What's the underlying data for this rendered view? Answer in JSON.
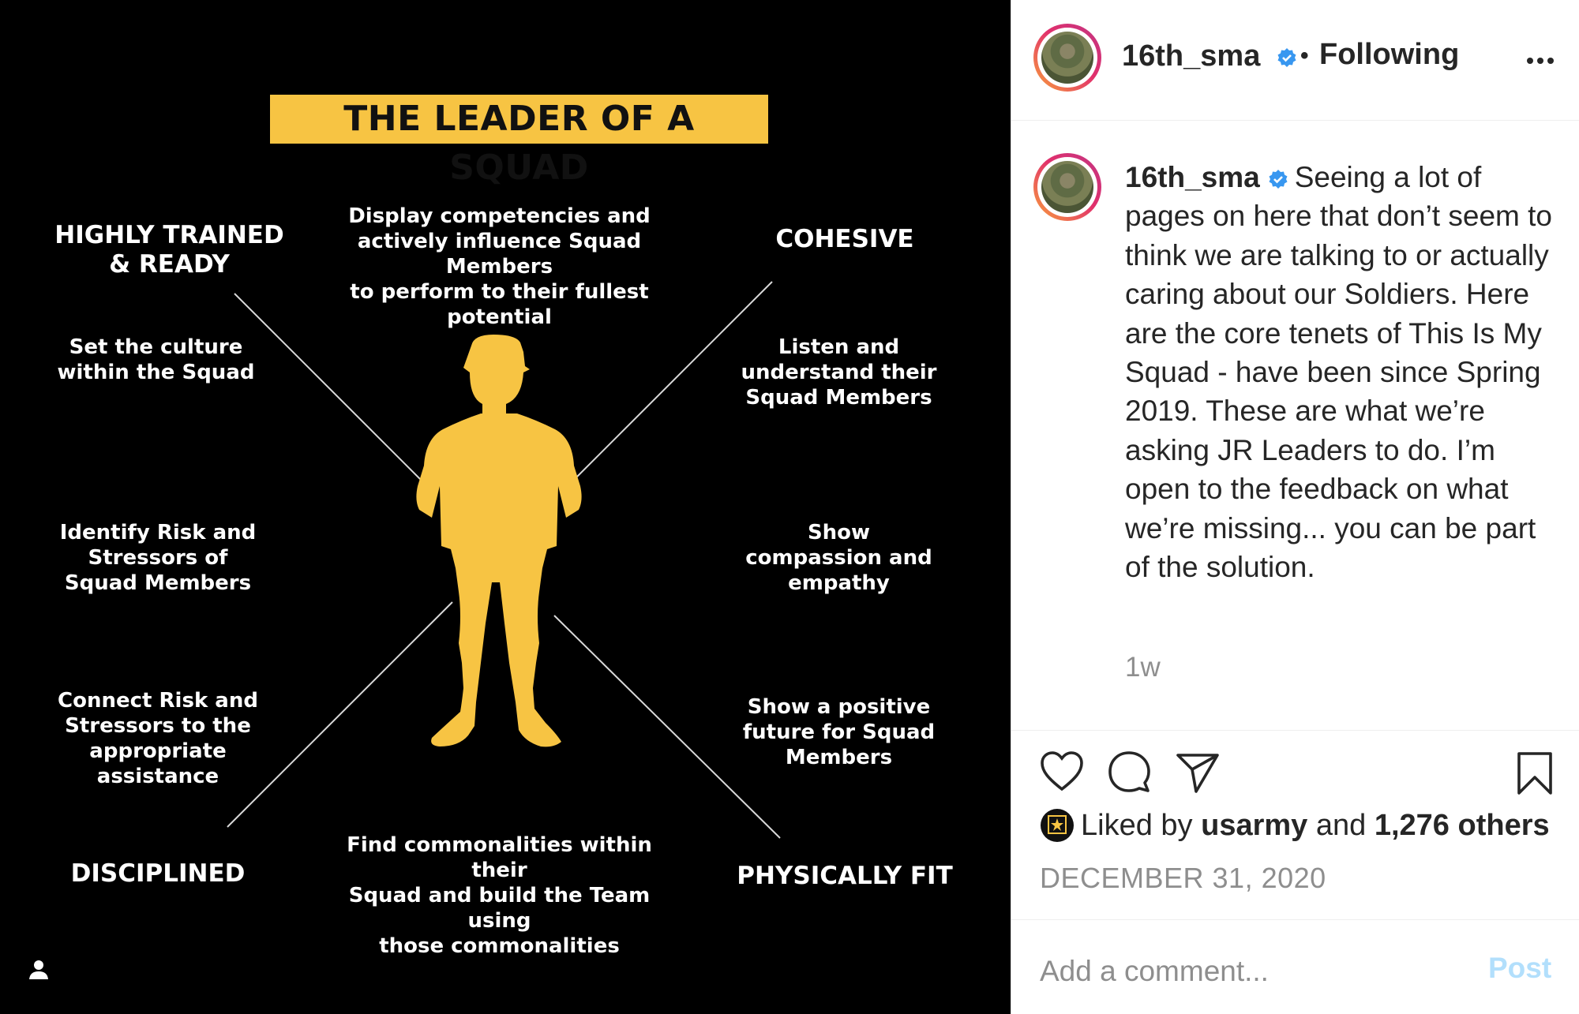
{
  "graphic": {
    "title": "THE LEADER OF A SQUAD",
    "corners": {
      "top_left": "HIGHLY TRAINED\n& READY",
      "top_right": "COHESIVE",
      "bottom_left": "DISCIPLINED",
      "bottom_right": "PHYSICALLY FIT"
    },
    "top_center": "Display competencies and\nactively influence Squad Members\nto perform to their fullest potential",
    "bottom_center": "Find commonalities within their\nSquad and build the Team using\nthose commonalities",
    "left_items": [
      "Set the culture\nwithin the Squad",
      "Identify Risk and\nStressors of\nSquad Members",
      "Connect Risk and\nStressors to the\nappropriate\nassistance"
    ],
    "right_items": [
      "Listen and\nunderstand their\nSquad Members",
      "Show\ncompassion and\nempathy",
      "Show a positive\nfuture for Squad\nMembers"
    ],
    "accent_color": "#f7c443",
    "icons": {
      "tagged_users": "person-icon"
    }
  },
  "header": {
    "username": "16th_sma",
    "separator": "•",
    "follow_status": "Following",
    "more_icon": "more-options-icon"
  },
  "caption": {
    "username": "16th_sma",
    "text": "Seeing a lot of pages on here that don’t seem to think we are talking to or actually caring about our Soldiers. Here are the core tenets of This Is My Squad - have been since Spring 2019. These are what we’re asking JR Leaders to do. I’m open to the feedback on what we’re missing... you can be part of the solution.",
    "age": "1w"
  },
  "actions": {
    "icons": [
      "heart-icon",
      "comment-icon",
      "share-icon",
      "bookmark-icon"
    ]
  },
  "likes": {
    "prefix": "Liked by",
    "user": "usarmy",
    "conjunction": "and",
    "others": "1,276 others"
  },
  "date": "DECEMBER 31, 2020",
  "comment_box": {
    "placeholder": "Add a comment...",
    "post_label": "Post"
  },
  "colors": {
    "verified": "#3897f0",
    "post_disabled": "#b2dffc",
    "muted": "#8e8e8e"
  }
}
